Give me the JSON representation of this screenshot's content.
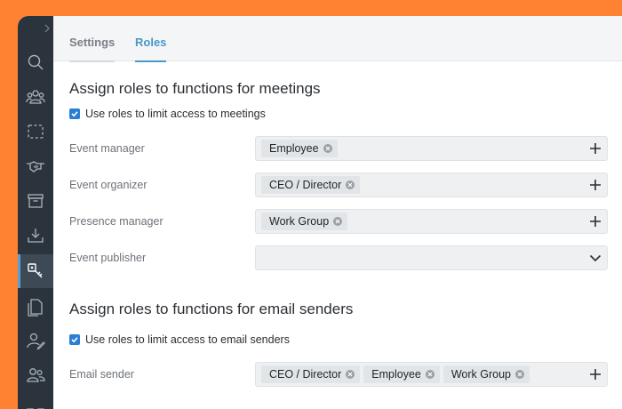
{
  "tabs": [
    {
      "label": "Settings",
      "active": false
    },
    {
      "label": "Roles",
      "active": true
    }
  ],
  "sidebar": {
    "items": [
      {
        "icon": "search-icon"
      },
      {
        "icon": "users-group-icon"
      },
      {
        "icon": "dashed-frame-icon"
      },
      {
        "icon": "handshake-icon"
      },
      {
        "icon": "archive-icon"
      },
      {
        "icon": "download-tray-icon"
      },
      {
        "icon": "key-icon",
        "active": true
      },
      {
        "icon": "documents-icon"
      },
      {
        "icon": "user-edit-icon"
      },
      {
        "icon": "user-pair-icon"
      },
      {
        "icon": "org-chart-icon"
      }
    ]
  },
  "meetings": {
    "title": "Assign roles to functions for meetings",
    "checkbox_label": "Use roles to limit access to meetings",
    "checked": true,
    "fields": [
      {
        "label": "Event manager",
        "tags": [
          "Employee"
        ],
        "action": "plus-icon"
      },
      {
        "label": "Event organizer",
        "tags": [
          "CEO / Director"
        ],
        "action": "plus-icon"
      },
      {
        "label": "Presence manager",
        "tags": [
          "Work Group"
        ],
        "action": "plus-icon"
      },
      {
        "label": "Event publisher",
        "tags": [],
        "action": "chevron-down-icon"
      }
    ]
  },
  "email": {
    "title": "Assign roles to functions for email senders",
    "checkbox_label": "Use roles to limit access to email senders",
    "checked": true,
    "fields": [
      {
        "label": "Email sender",
        "tags": [
          "CEO / Director",
          "Employee",
          "Work Group"
        ],
        "action": "plus-icon"
      }
    ]
  },
  "colors": {
    "accent": "#4a97c9",
    "background_orange": "#ff8232",
    "sidebar": "#2b343c",
    "checkbox": "#2a7fd4"
  }
}
